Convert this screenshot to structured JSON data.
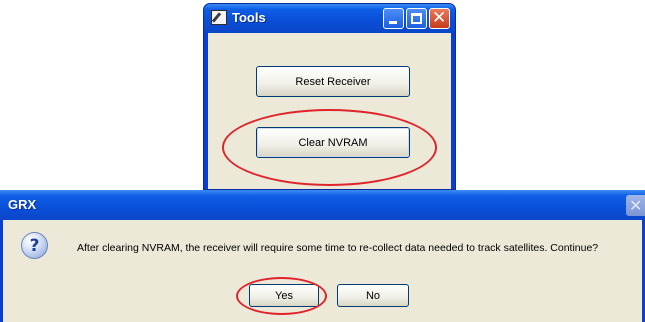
{
  "tools_window": {
    "title": "Tools",
    "icon": "tools-app-icon",
    "buttons": {
      "reset_receiver": "Reset Receiver",
      "clear_nvram": "Clear NVRAM"
    },
    "controls": [
      "minimize-icon",
      "maximize-icon",
      "close-icon"
    ]
  },
  "grx_dialog": {
    "title": "GRX",
    "icon": "question-icon",
    "message": "After clearing NVRAM, the receiver will require some time to re-collect data needed to track satellites. Continue?",
    "buttons": {
      "yes": "Yes",
      "no": "No"
    }
  },
  "colors": {
    "highlight": "#e0242b",
    "titlebar": "#0a4fd8",
    "dialog_bg": "#ece9d8"
  }
}
